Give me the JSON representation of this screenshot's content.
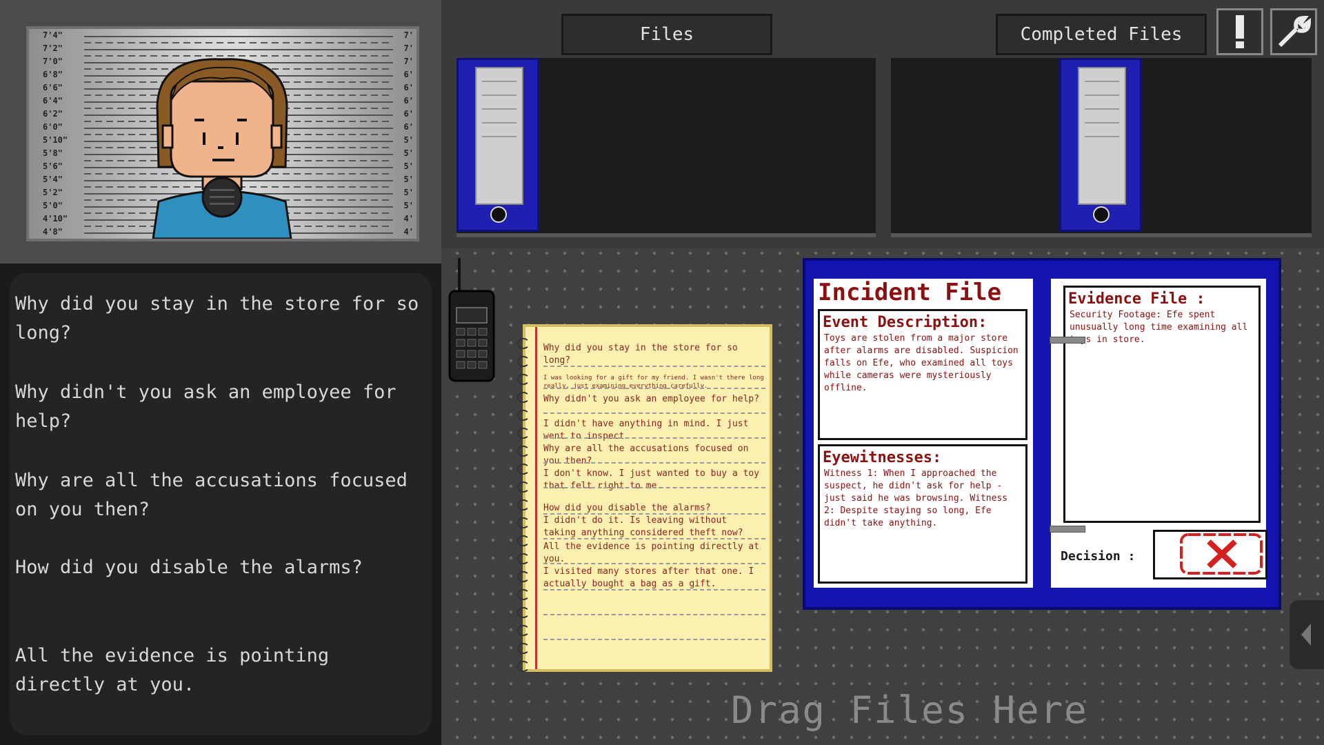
{
  "mugshot": {
    "heights": [
      "7'4\"",
      "7'2\"",
      "7'0\"",
      "6'8\"",
      "6'6\"",
      "6'4\"",
      "6'2\"",
      "6'0\"",
      "5'10\"",
      "5'8\"",
      "5'6\"",
      "5'4\"",
      "5'2\"",
      "5'0\"",
      "4'10\"",
      "4'8\""
    ],
    "right_heights": [
      "7'",
      "7'",
      "7'",
      "6'",
      "6'",
      "6'",
      "6'",
      "6'",
      "5'",
      "5'",
      "5'",
      "5'",
      "5'",
      "5'",
      "4'",
      "4'"
    ]
  },
  "dialogue": [
    "Why did you stay in the store for so long?",
    "Why didn't you ask an employee for help?",
    "Why are all the accusations focused on you then?",
    "How did you disable the alarms?",
    "All the evidence is pointing directly at you."
  ],
  "tabs": {
    "files": "Files",
    "completed": "Completed Files"
  },
  "notepad": [
    "Why did you stay in the store for so long?",
    "I was looking for a gift for my friend. I wasn't there long really, just examining everything carefully.",
    "Why didn't you ask an employee for help?",
    "I didn't have anything in mind. I just went to inspect.",
    "Why are all the accusations focused on you then?",
    "I don't know. I just wanted to buy a toy that felt right to me.",
    "How did you disable the alarms?",
    "I didn't do it. Is leaving without taking anything considered theft now?",
    "All the evidence is pointing directly at you.",
    "I visited many stores after that one. I actually bought a bag as a gift."
  ],
  "incident": {
    "title": "Incident File",
    "event_title": "Event Description:",
    "event_text": "Toys are stolen from a major store after alarms are disabled. Suspicion falls on Efe, who examined all toys while cameras were mysteriously offline.",
    "witness_title": "Eyewitnesses:",
    "witness_text": "Witness 1: When I approached the suspect, he didn't ask for help - just said he was browsing. Witness 2: Despite staying so long, Efe didn't take anything.",
    "evidence_title": "Evidence File :",
    "evidence_text": "Security Footage: Efe spent unusually long time examining all toys in store.",
    "decision_label": "Decision :"
  },
  "desk": {
    "drag_hint": "Drag Files Here"
  }
}
